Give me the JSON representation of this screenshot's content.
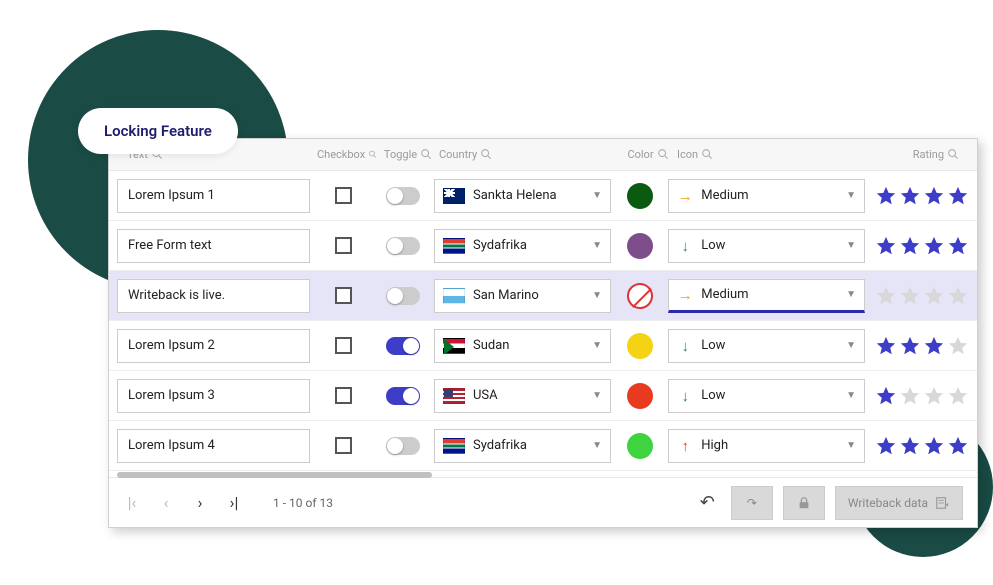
{
  "badge": "Locking Feature",
  "columns": {
    "text": "Text",
    "checkbox": "Checkbox",
    "toggle": "Toggle",
    "country": "Country",
    "color": "Color",
    "icon": "Icon",
    "rating": "Rating"
  },
  "rows": [
    {
      "text": "Lorem Ipsum 1",
      "checked": false,
      "toggle": false,
      "country": "Sankta Helena",
      "flag": "sh",
      "color": "#0b5a12",
      "icon": {
        "dir": "right",
        "color": "#f39c12",
        "label": "Medium"
      },
      "rating": 4,
      "active": false
    },
    {
      "text": "Free Form text",
      "checked": false,
      "toggle": false,
      "country": "Sydafrika",
      "flag": "za",
      "color": "#7d4e8a",
      "icon": {
        "dir": "down",
        "color": "#2e8b3d",
        "label": "Low"
      },
      "rating": 4,
      "active": false
    },
    {
      "text": "Writeback is live.",
      "checked": false,
      "toggle": false,
      "country": "San Marino",
      "flag": "sm",
      "color": "none",
      "icon": {
        "dir": "right",
        "color": "#f39c12",
        "label": "Medium"
      },
      "rating": 0,
      "active": true
    },
    {
      "text": "Lorem Ipsum 2",
      "checked": false,
      "toggle": true,
      "country": "Sudan",
      "flag": "sd",
      "color": "#f4d314",
      "icon": {
        "dir": "down",
        "color": "#2e8b3d",
        "label": "Low"
      },
      "rating": 3,
      "active": false
    },
    {
      "text": "Lorem Ipsum 3",
      "checked": false,
      "toggle": true,
      "country": "USA",
      "flag": "us",
      "color": "#e83a1f",
      "icon": {
        "dir": "down",
        "color": "#2e8b3d",
        "label": "Low"
      },
      "rating": 1,
      "active": false
    },
    {
      "text": "Lorem Ipsum 4",
      "checked": false,
      "toggle": false,
      "country": "Sydafrika",
      "flag": "za",
      "color": "#3fd43f",
      "icon": {
        "dir": "up",
        "color": "#e83a1f",
        "label": "High"
      },
      "rating": 4,
      "active": false
    }
  ],
  "pagination": "1 - 10 of 13",
  "footer": {
    "writeback": "Writeback data"
  }
}
